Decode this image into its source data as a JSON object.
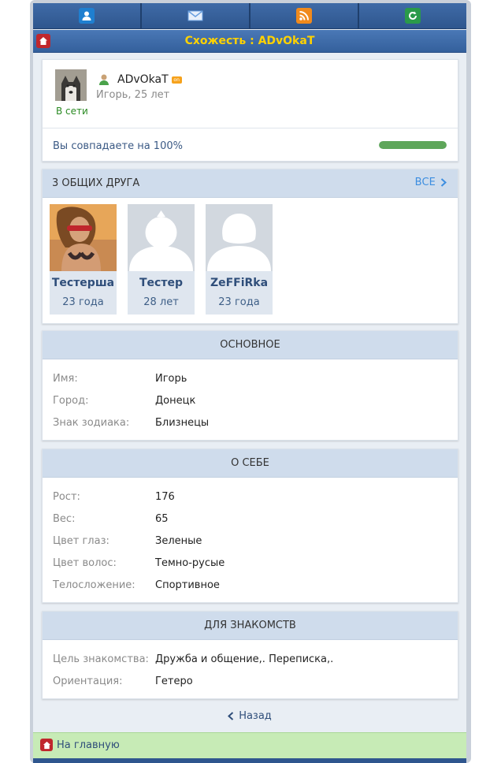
{
  "header": {
    "title": "Схожесть : ADvOkaT"
  },
  "topnav": [
    {
      "icon": "contacts-icon",
      "color": "#1f7fd0"
    },
    {
      "icon": "mail-icon",
      "color": "#2a66c8"
    },
    {
      "icon": "rss-icon",
      "color": "#f08a1c"
    },
    {
      "icon": "refresh-icon",
      "color": "#2a9a4a"
    }
  ],
  "profile": {
    "username": "ADvOkaT",
    "badge": "on",
    "sub": "Игорь, 25 лет",
    "status": "В сети",
    "match_text": "Вы совпадаете на 100%",
    "match_percent": 100
  },
  "friends": {
    "heading": "3 ОБЩИХ ДРУГА",
    "all_label": "ВСЕ",
    "items": [
      {
        "name": "Тестерша",
        "age": "23 года"
      },
      {
        "name": "Тестер",
        "age": "28 лет"
      },
      {
        "name": "ZeFFiRka",
        "age": "23 года"
      }
    ]
  },
  "basic": {
    "heading": "ОСНОВНОЕ",
    "rows": [
      {
        "k": "Имя:",
        "v": "Игорь"
      },
      {
        "k": "Город:",
        "v": "Донецк"
      },
      {
        "k": "Знак зодиака:",
        "v": "Близнецы"
      }
    ]
  },
  "about": {
    "heading": "О СЕБЕ",
    "rows": [
      {
        "k": "Рост:",
        "v": "176"
      },
      {
        "k": "Вес:",
        "v": "65"
      },
      {
        "k": "Цвет глаз:",
        "v": "Зеленые"
      },
      {
        "k": "Цвет волос:",
        "v": "Темно-русые"
      },
      {
        "k": "Телосложение:",
        "v": "Спортивное"
      }
    ]
  },
  "dating": {
    "heading": "ДЛЯ ЗНАКОМСТВ",
    "rows": [
      {
        "k": "Цель знакомства:",
        "v": "Дружба и общение,. Переписка,."
      },
      {
        "k": "Ориентация:",
        "v": "Гетеро"
      }
    ]
  },
  "nav": {
    "back": "Назад",
    "home": "На главную"
  }
}
